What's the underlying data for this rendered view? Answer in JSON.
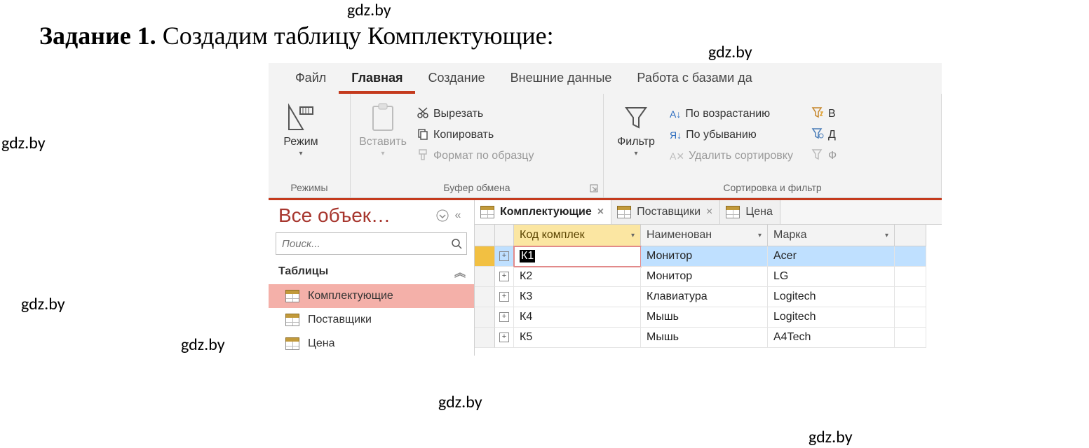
{
  "heading": {
    "bold": "Задание 1.",
    "rest": " Создадим таблицу Комплектующие:"
  },
  "watermarks": [
    "gdz.by",
    "gdz.by",
    "gdz.by",
    "gdz.by",
    "gdz.by",
    "gdz.by",
    "gdz.by",
    "gdz.by"
  ],
  "ribbon": {
    "tabs": [
      "Файл",
      "Главная",
      "Создание",
      "Внешние данные",
      "Работа с базами да"
    ],
    "active_index": 1,
    "groups": {
      "views": {
        "label": "Режимы",
        "view_btn": "Режим"
      },
      "clipboard": {
        "label": "Буфер обмена",
        "paste": "Вставить",
        "cut": "Вырезать",
        "copy": "Копировать",
        "format_painter": "Формат по образцу"
      },
      "sortfilter": {
        "label": "Сортировка и фильтр",
        "filter": "Фильтр",
        "asc": "По возрастанию",
        "desc": "По убыванию",
        "clear": "Удалить сортировку",
        "extra1": "В",
        "extra2": "Д",
        "extra3": "Ф"
      }
    }
  },
  "nav": {
    "title": "Все объек…",
    "search_placeholder": "Поиск...",
    "category": "Таблицы",
    "items": [
      "Комплектующие",
      "Поставщики",
      "Цена"
    ],
    "selected_index": 0
  },
  "tabs": {
    "items": [
      "Комплектующие",
      "Поставщики",
      "Цена"
    ],
    "active_index": 0
  },
  "grid": {
    "columns": [
      "Код комплек",
      "Наименован",
      "Марка"
    ],
    "rows": [
      {
        "key": "К1",
        "name": "Монитор",
        "brand": "Acer",
        "editing": true,
        "selected": true
      },
      {
        "key": "К2",
        "name": "Монитор",
        "brand": "LG"
      },
      {
        "key": "К3",
        "name": "Клавиатура",
        "brand": "Logitech"
      },
      {
        "key": "К4",
        "name": "Мышь",
        "brand": "Logitech"
      },
      {
        "key": "К5",
        "name": "Мышь",
        "brand": "A4Tech"
      }
    ]
  }
}
